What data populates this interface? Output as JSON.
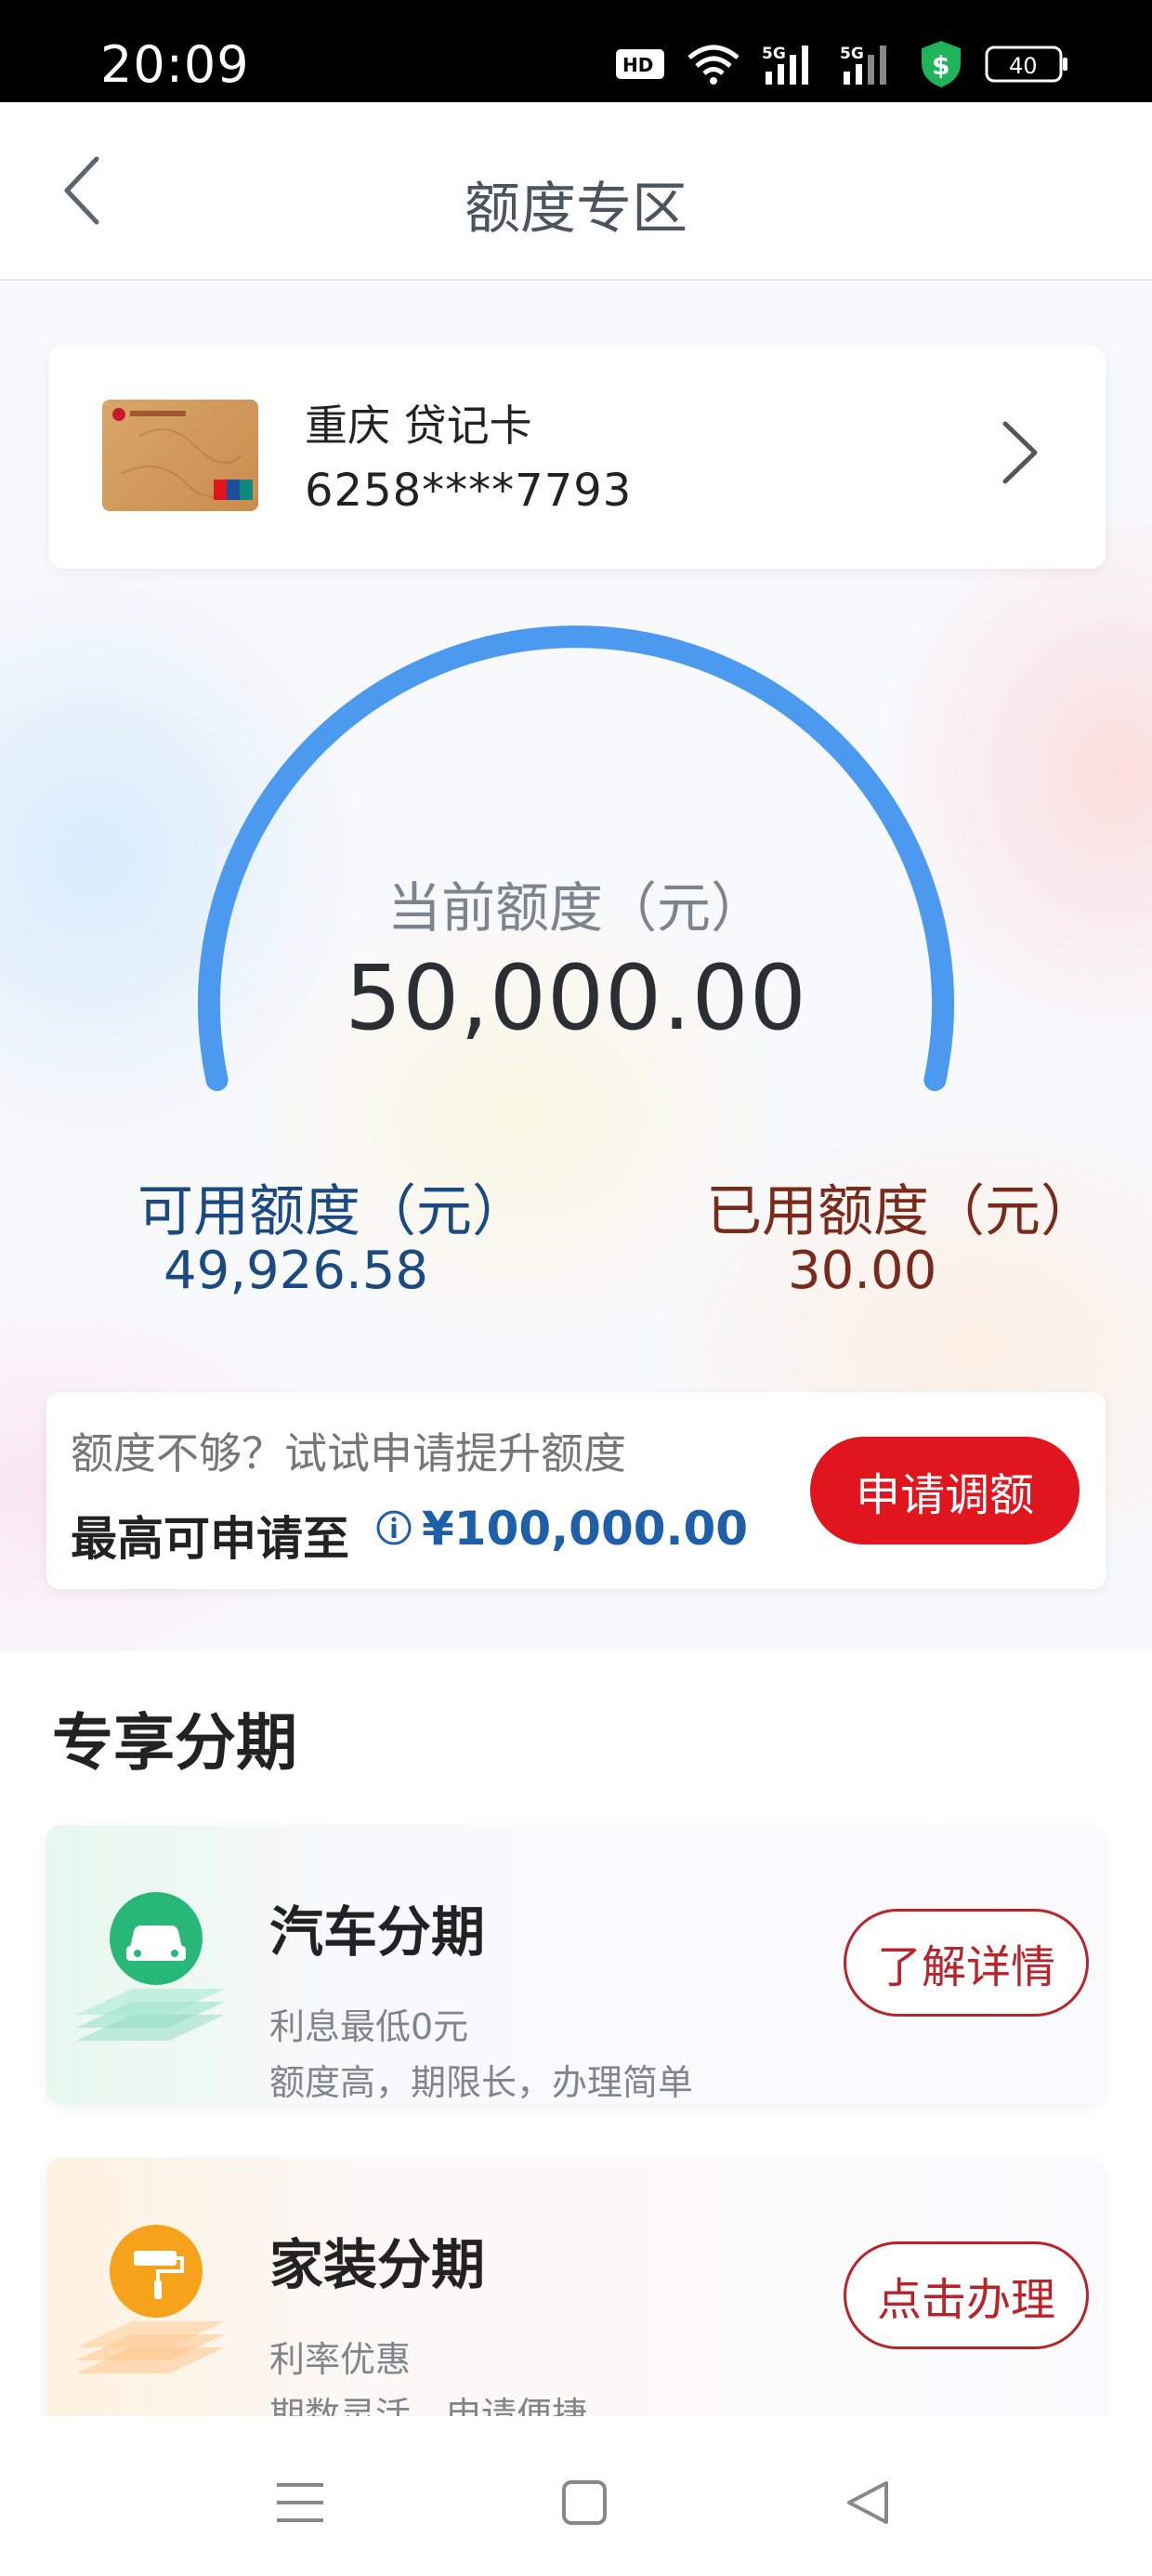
{
  "status_bar": {
    "time": "20:09",
    "battery": "40",
    "icons": [
      "hd-icon",
      "wifi-icon",
      "signal-5g-icon",
      "signal-5g-icon",
      "shield-dollar-icon",
      "battery-icon"
    ]
  },
  "header": {
    "title": "额度专区",
    "back_icon": "chevron-left-icon"
  },
  "card": {
    "name": "重庆 贷记卡",
    "number": "6258****7793",
    "chevron_icon": "chevron-right-icon"
  },
  "gauge": {
    "label": "当前额度（元）",
    "value": "50,000.00",
    "used_fraction": 0.0006,
    "color": "#4b9af0"
  },
  "available": {
    "label": "可用额度（元）",
    "value": "49,926.58"
  },
  "used": {
    "label": "已用额度（元）",
    "value": "30.00"
  },
  "raise": {
    "question": "额度不够？试试申请提升额度",
    "max_label": "最高可申请至",
    "max_value": "¥100,000.00",
    "button": "申请调额"
  },
  "section": {
    "title": "专享分期"
  },
  "loans": [
    {
      "title": "汽车分期",
      "line1": "利息最低0元",
      "line2": "额度高，期限长，办理简单",
      "button": "了解详情",
      "icon": "car-icon",
      "accent": "#27b877"
    },
    {
      "title": "家装分期",
      "line1": "利率优惠",
      "line2": "期数灵活，申请便捷",
      "button": "点击办理",
      "icon": "paint-roller-icon",
      "accent": "#f7a21b"
    }
  ],
  "system_nav": {
    "icons": [
      "menu-icon",
      "home-icon",
      "back-triangle-icon"
    ]
  },
  "colors": {
    "primary_red": "#e0151e",
    "outline_red": "#b8242a",
    "blue_text": "#1b4a82",
    "brown_text": "#7a2a1a",
    "link_blue": "#1d5fa8"
  }
}
